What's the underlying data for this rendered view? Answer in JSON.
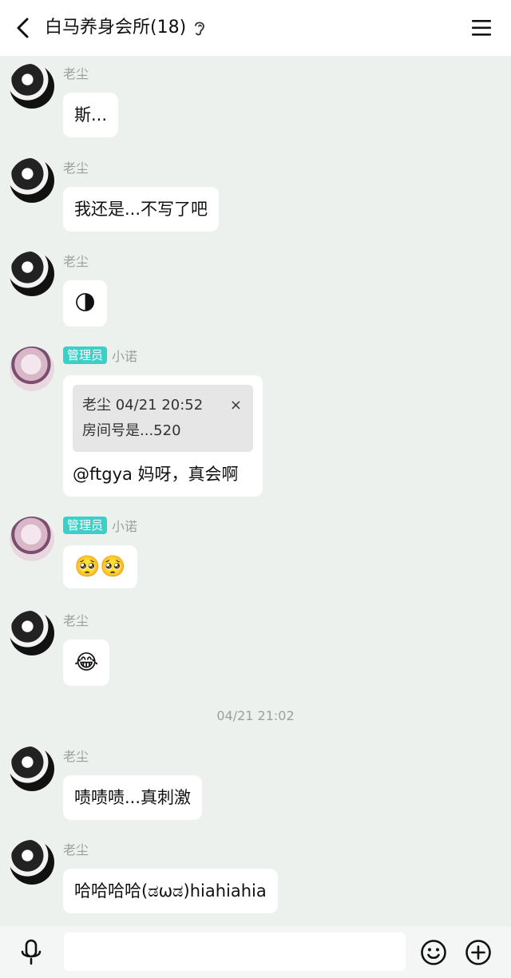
{
  "header": {
    "title": "白马养身会所(18)"
  },
  "messages": [
    {
      "sender": "老尘",
      "text": "斯..."
    },
    {
      "sender": "老尘",
      "text": "我还是...不写了吧"
    },
    {
      "sender": "老尘",
      "emoji": "🌗"
    },
    {
      "sender": "小诺",
      "badge": "管理员",
      "quote": {
        "author_time": "老尘 04/21 20:52",
        "text": "房间号是...520",
        "close": "×"
      },
      "text": "@ftgya 妈呀，真会啊"
    },
    {
      "sender": "小诺",
      "badge": "管理员",
      "emoji": "🥺🥺"
    },
    {
      "sender": "老尘",
      "emoji": "😂"
    },
    {
      "sender": "老尘",
      "text": "啧啧啧...真刺激"
    },
    {
      "sender": "老尘",
      "text": "哈哈哈哈(ಡωಡ)hiahiahia"
    }
  ],
  "time_separator": "04/21 21:02",
  "input": {
    "placeholder": "",
    "value": ""
  },
  "icons": {
    "back": "chevron-left-icon",
    "ear": "ear-icon",
    "menu": "menu-icon",
    "mic": "microphone-icon",
    "emoji": "smiley-icon",
    "plus": "plus-circle-icon"
  },
  "colors": {
    "background": "#edf1ee",
    "badge": "#3ccfc8",
    "bubble": "#ffffff"
  }
}
